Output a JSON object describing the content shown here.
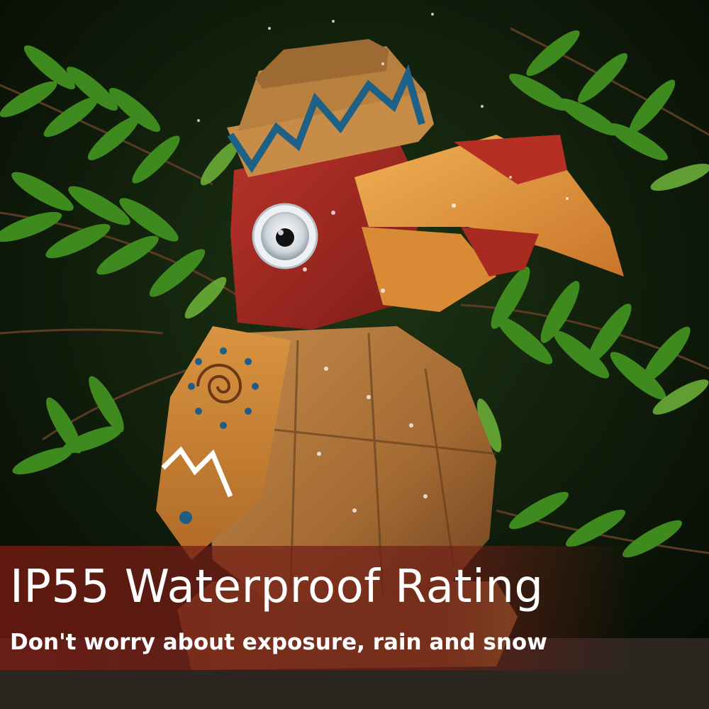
{
  "headline": "IP55 Waterproof Rating",
  "subline": "Don't worry about exposure, rain and snow",
  "colors": {
    "foliage_dark": "#0b1208",
    "fern_green": "#3f8a1f",
    "fern_light": "#6fb63a",
    "wood": "#b07a3e",
    "wood_dark": "#7a4a22",
    "head_red": "#a82a22",
    "beak_orange": "#e79a3b",
    "zigzag_blue": "#2b6e8c",
    "banner": "#7a1c14",
    "text": "#ffffff"
  },
  "icons": [
    "fern-leaf",
    "solar-eye",
    "zigzag-pattern",
    "spiral-pattern"
  ]
}
